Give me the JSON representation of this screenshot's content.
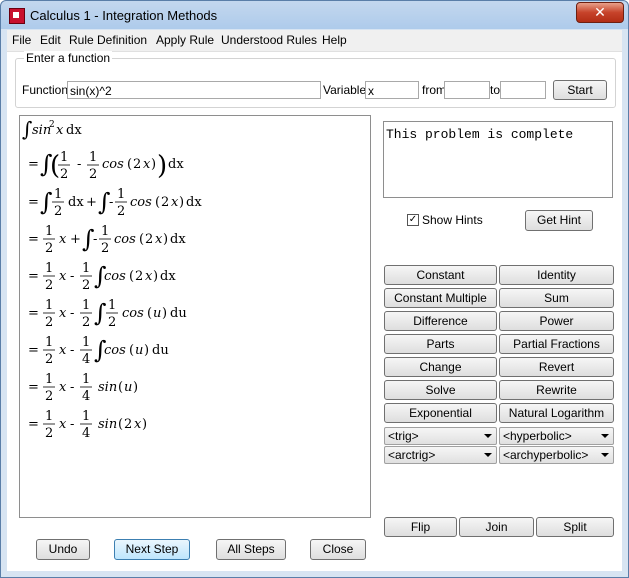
{
  "window": {
    "title": "Calculus 1 - Integration Methods",
    "close_label": "✕"
  },
  "menu": [
    "File",
    "Edit",
    "Rule Definition",
    "Apply Rule",
    "Understood Rules",
    "Help"
  ],
  "input_panel": {
    "legend": "Enter a function",
    "function_label": "Function",
    "function_value": "sin(x)^2",
    "variable_label": "Variable",
    "variable_value": "x",
    "from_label": "from",
    "from_value": "",
    "to_label": "to",
    "to_value": "",
    "start_label": "Start"
  },
  "status_text": "This problem is complete",
  "hints": {
    "show_hints_label": "Show Hints",
    "checked": true,
    "get_hint_label": "Get Hint"
  },
  "rules": [
    [
      "Constant",
      "Identity"
    ],
    [
      "Constant Multiple",
      "Sum"
    ],
    [
      "Difference",
      "Power"
    ],
    [
      "Parts",
      "Partial Fractions"
    ],
    [
      "Change",
      "Revert"
    ],
    [
      "Solve",
      "Rewrite"
    ],
    [
      "Exponential",
      "Natural Logarithm"
    ]
  ],
  "dropdowns": [
    [
      "<trig>",
      "<hyperbolic>"
    ],
    [
      "<arctrig>",
      "<archyperbolic>"
    ]
  ],
  "transform_buttons": [
    "Flip",
    "Join",
    "Split"
  ],
  "bottom_buttons": [
    "Undo",
    "Next Step",
    "All Steps",
    "Close"
  ],
  "math": {
    "dx": "dx",
    "du": "du",
    "x": "x",
    "u": "u",
    "one": "1",
    "two": "2",
    "four": "4",
    "sin": "sin",
    "cos": "cos",
    "eq": "=",
    "plus": "+",
    "minus": "-",
    "integral": "∫",
    "sq": "2",
    "lparen": "(",
    "rparen": ")"
  }
}
